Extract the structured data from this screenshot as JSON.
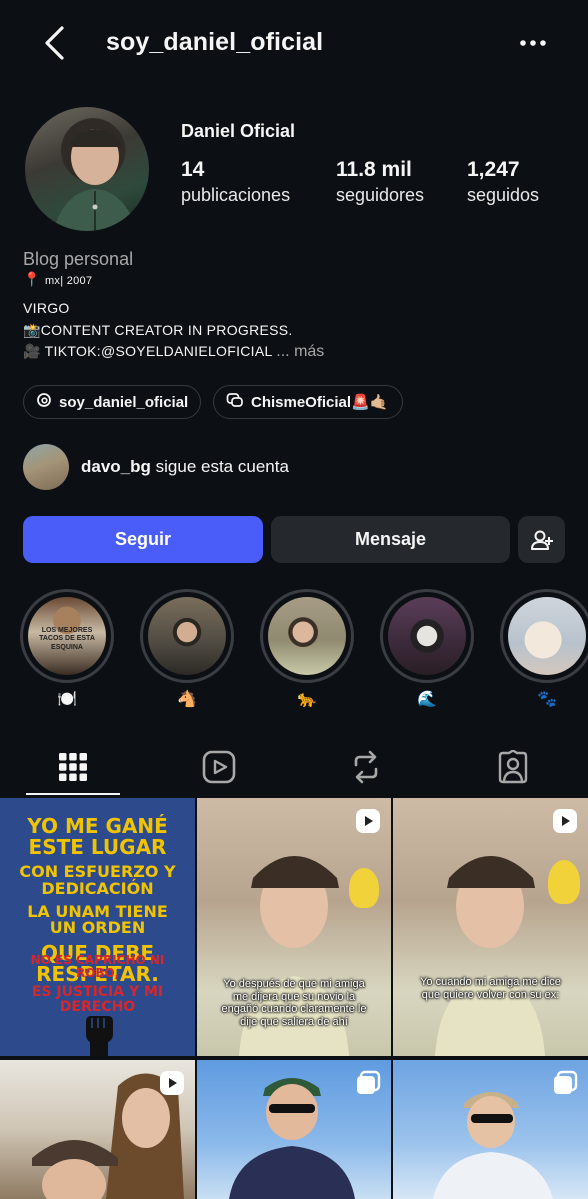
{
  "header": {
    "username": "soy_daniel_oficial"
  },
  "profile": {
    "display_name": "Daniel Oficial",
    "stats": [
      {
        "value": "14",
        "label": "publicaciones"
      },
      {
        "value": "11.8 mil",
        "label": "seguidores"
      },
      {
        "value": "1,247",
        "label": "seguidos"
      }
    ],
    "category": "Blog personal",
    "bio": {
      "line1_pin": "📍",
      "line1_text": "mx| 2007",
      "line2": "VIRGO",
      "line3_icon": "📸",
      "line3_text": "CONTENT CREATOR IN PROGRESS.",
      "line4_icon": "🎥",
      "line4_text": "TIKTOK:@SOYELDANIELOFICIAL",
      "more": "... más"
    },
    "chips": [
      {
        "icon": "threads-icon",
        "label": "soy_daniel_oficial"
      },
      {
        "icon": "channel-icon",
        "label": "ChismeOficial🚨🤙🏼"
      }
    ],
    "followed_by": {
      "name": "davo_bg",
      "text": "sigue esta cuenta"
    }
  },
  "actions": {
    "follow": "Seguir",
    "message": "Mensaje"
  },
  "highlights": [
    {
      "label": "🍽️",
      "caption": "LOS MEJORES TACOS DE ESTA ESQUINA"
    },
    {
      "label": "🐴",
      "caption": ""
    },
    {
      "label": "🐆",
      "caption": ""
    },
    {
      "label": "🌊",
      "caption": ""
    },
    {
      "label": "🐾",
      "caption": ""
    }
  ],
  "tabs": [
    "grid-icon",
    "reels-icon",
    "reposts-icon",
    "tagged-icon"
  ],
  "posts": [
    {
      "type": "poster",
      "lines_yellow": [
        "YO ME GANÉ ESTE LUGAR",
        "CON ESFUERZO Y DEDICACIÓN",
        "LA UNAM TIENE UN ORDEN",
        "QUE DEBE RESPETAR."
      ],
      "lines_red": [
        "NO ES CAPRICHO NI ROBO,",
        "ES JUSTICIA Y MI DERECHO"
      ]
    },
    {
      "type": "reel",
      "caption": "Yo después de que mi amiga me dijera que su novio la engañó cuando claramente le dije que saliera de ahí"
    },
    {
      "type": "reel",
      "caption": "Yo cuando mi amiga me dice que quiere volver con su ex:"
    },
    {
      "type": "reel",
      "caption": ""
    },
    {
      "type": "carousel",
      "caption": ""
    },
    {
      "type": "carousel",
      "caption": ""
    }
  ],
  "colors": {
    "background": "#0c1014",
    "accent": "#4a5df9",
    "secondary_button": "#25292e",
    "muted_text": "#a8a8a8"
  }
}
